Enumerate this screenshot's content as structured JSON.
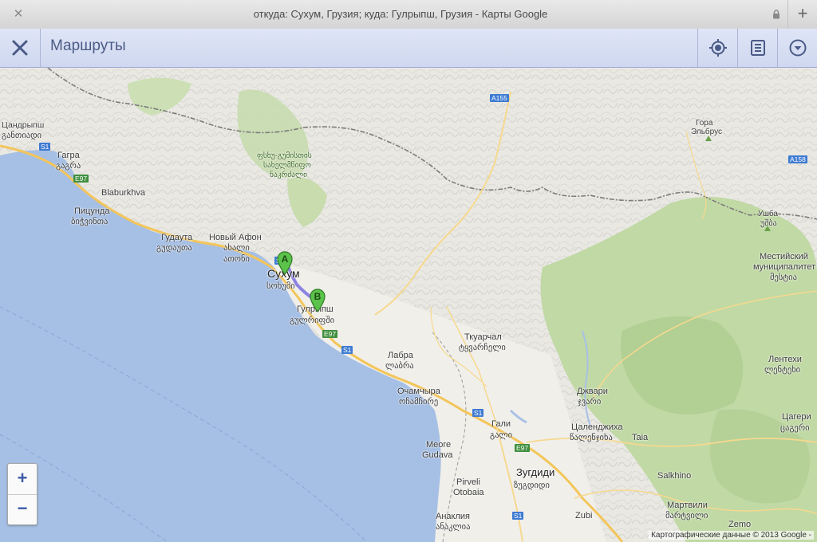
{
  "browser": {
    "tab_title": "откуда: Сухум, Грузия; куда: Гулрыпш, Грузия - Карты Google"
  },
  "header": {
    "title": "Маршруты"
  },
  "map": {
    "labels": {
      "gagra": "Гагра",
      "gagra_geo": "გაგრა",
      "tsandrypsh": "Цандрыпш",
      "tsandrypsh_geo": "განთიადი",
      "blaburkhva": "Blaburkhva",
      "pitsunda": "Пицунда",
      "pitsunda_geo": "ბიჭვინთა",
      "gudauta": "Гудаута",
      "gudauta_geo": "გუდაუთა",
      "new_athos": "Новый Афон",
      "new_athos_geo1": "ახალი",
      "new_athos_geo2": "ათონი",
      "sukhum": "Сухум",
      "sukhum_geo": "სოხუმი",
      "gulrypsh": "Гулрыпш",
      "gulrypsh_geo": "გულრიფში",
      "labra": "Лабра",
      "labra_geo": "ლაბრა",
      "ochamchira": "Очамчыра",
      "ochamchira_geo": "ოჩამჩირე",
      "tkvarcheli": "Ткуарчал",
      "tkvarcheli_geo": "ტყვარჩელი",
      "gali": "Гали",
      "gali_geo": "გალი",
      "meore": "Meore",
      "gudava": "Gudava",
      "pirveli": "Pirveli",
      "otobaia": "Otobaia",
      "anaklia": "Анаклия",
      "anaklia_geo": "ანაკლია",
      "zugdidi": "Зугдиди",
      "zugdidi_geo": "ზუგდიდი",
      "zubi": "Zubi",
      "jvari": "Джвари",
      "jvari_geo": "ჯვარი",
      "tsalenjikha": "Цаленджиха",
      "tsalenjikha_geo": "წალენჯიხა",
      "taia": "Taia",
      "salkhino": "Salkhino",
      "martvili": "Мартвили",
      "martvili_geo": "მარტვილი",
      "zemo": "Zemo",
      "lentekhi": "Лентехи",
      "lentekhi_geo": "ლენტეხი",
      "tsageri": "Цагери",
      "tsageri_geo": "ცაგერი",
      "mestia1": "Местийский",
      "mestia2": "муниципалитет",
      "mestia_geo": "მესტია",
      "ushba": "Ушба",
      "ushba_geo": "უშბა",
      "elbrus1": "Гора",
      "elbrus2": "Эльбрус",
      "reserve1": "ფსხუ-გუმისთის",
      "reserve2": "სახელმწიფო",
      "reserve3": "ნაკრძალი"
    },
    "road_shields": {
      "a155": "A155",
      "a158": "A158",
      "s1_a": "S1",
      "s1_b": "S1",
      "s1_c": "S1",
      "s1_d": "S1",
      "s1_e": "S1",
      "e97_a": "E97",
      "e97_b": "E97",
      "e97_c": "E97"
    },
    "markers": {
      "start": "A",
      "end": "B"
    },
    "route_color": "#7b6ee0",
    "water_color": "#99b3dd",
    "land_color": "#eeece6",
    "forest_color": "#bcd6a0",
    "zoom_in": "+",
    "zoom_out": "−",
    "attribution": "Картографические данные © 2013 Google -"
  }
}
